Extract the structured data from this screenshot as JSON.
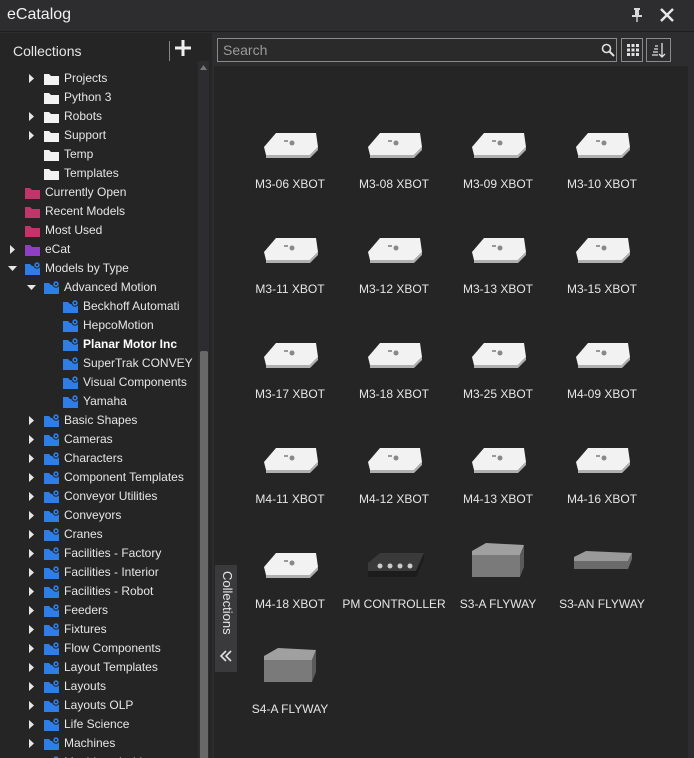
{
  "window": {
    "title": "eCatalog"
  },
  "left": {
    "header": "Collections",
    "tree": [
      {
        "label": "Projects",
        "level": 2,
        "chevron": "right",
        "icon": "folder-white"
      },
      {
        "label": "Python 3",
        "level": 2,
        "chevron": "none",
        "icon": "folder-white"
      },
      {
        "label": "Robots",
        "level": 2,
        "chevron": "right",
        "icon": "folder-white"
      },
      {
        "label": "Support",
        "level": 2,
        "chevron": "right",
        "icon": "folder-white"
      },
      {
        "label": "Temp",
        "level": 2,
        "chevron": "none",
        "icon": "folder-white"
      },
      {
        "label": "Templates",
        "level": 2,
        "chevron": "none",
        "icon": "folder-white"
      },
      {
        "label": "Currently Open",
        "level": 1,
        "chevron": "none",
        "icon": "folder-pink"
      },
      {
        "label": "Recent Models",
        "level": 1,
        "chevron": "none",
        "icon": "folder-pink"
      },
      {
        "label": "Most Used",
        "level": 1,
        "chevron": "none",
        "icon": "folder-pink"
      },
      {
        "label": "eCat",
        "level": 1,
        "chevron": "right",
        "icon": "folder-purple"
      },
      {
        "label": "Models by Type",
        "level": 1,
        "chevron": "down",
        "icon": "folder-blue-gear"
      },
      {
        "label": "Advanced Motion",
        "level": 2,
        "chevron": "down",
        "icon": "folder-blue-gear"
      },
      {
        "label": "Beckhoff Automati",
        "level": 3,
        "chevron": "none",
        "icon": "folder-blue-gear"
      },
      {
        "label": "HepcoMotion",
        "level": 3,
        "chevron": "none",
        "icon": "folder-blue-gear"
      },
      {
        "label": "Planar Motor Inc",
        "level": 3,
        "chevron": "none",
        "icon": "folder-blue-gear",
        "bold": true
      },
      {
        "label": "SuperTrak CONVEY",
        "level": 3,
        "chevron": "none",
        "icon": "folder-blue-gear"
      },
      {
        "label": "Visual Components",
        "level": 3,
        "chevron": "none",
        "icon": "folder-blue-gear"
      },
      {
        "label": "Yamaha",
        "level": 3,
        "chevron": "none",
        "icon": "folder-blue-gear"
      },
      {
        "label": "Basic Shapes",
        "level": 2,
        "chevron": "right",
        "icon": "folder-blue-gear"
      },
      {
        "label": "Cameras",
        "level": 2,
        "chevron": "right",
        "icon": "folder-blue-gear"
      },
      {
        "label": "Characters",
        "level": 2,
        "chevron": "right",
        "icon": "folder-blue-gear"
      },
      {
        "label": "Component Templates",
        "level": 2,
        "chevron": "right",
        "icon": "folder-blue-gear"
      },
      {
        "label": "Conveyor Utilities",
        "level": 2,
        "chevron": "right",
        "icon": "folder-blue-gear"
      },
      {
        "label": "Conveyors",
        "level": 2,
        "chevron": "right",
        "icon": "folder-blue-gear"
      },
      {
        "label": "Cranes",
        "level": 2,
        "chevron": "right",
        "icon": "folder-blue-gear"
      },
      {
        "label": "Facilities - Factory",
        "level": 2,
        "chevron": "right",
        "icon": "folder-blue-gear"
      },
      {
        "label": "Facilities - Interior",
        "level": 2,
        "chevron": "right",
        "icon": "folder-blue-gear"
      },
      {
        "label": "Facilities - Robot",
        "level": 2,
        "chevron": "right",
        "icon": "folder-blue-gear"
      },
      {
        "label": "Feeders",
        "level": 2,
        "chevron": "right",
        "icon": "folder-blue-gear"
      },
      {
        "label": "Fixtures",
        "level": 2,
        "chevron": "right",
        "icon": "folder-blue-gear"
      },
      {
        "label": "Flow Components",
        "level": 2,
        "chevron": "right",
        "icon": "folder-blue-gear"
      },
      {
        "label": "Layout Templates",
        "level": 2,
        "chevron": "right",
        "icon": "folder-blue-gear"
      },
      {
        "label": "Layouts",
        "level": 2,
        "chevron": "right",
        "icon": "folder-blue-gear"
      },
      {
        "label": "Layouts OLP",
        "level": 2,
        "chevron": "right",
        "icon": "folder-blue-gear"
      },
      {
        "label": "Life Science",
        "level": 2,
        "chevron": "right",
        "icon": "folder-blue-gear"
      },
      {
        "label": "Machines",
        "level": 2,
        "chevron": "right",
        "icon": "folder-blue-gear"
      },
      {
        "label": "Machines In-Line",
        "level": 2,
        "chevron": "right",
        "icon": "folder-blue-gear"
      }
    ]
  },
  "side_tab": {
    "label": "Collections"
  },
  "search": {
    "placeholder": "Search"
  },
  "items": [
    {
      "label": "M3-06 XBOT",
      "kind": "xbot"
    },
    {
      "label": "M3-08 XBOT",
      "kind": "xbot"
    },
    {
      "label": "M3-09 XBOT",
      "kind": "xbot"
    },
    {
      "label": "M3-10 XBOT",
      "kind": "xbot"
    },
    {
      "label": "M3-11 XBOT",
      "kind": "xbot"
    },
    {
      "label": "M3-12 XBOT",
      "kind": "xbot"
    },
    {
      "label": "M3-13 XBOT",
      "kind": "xbot"
    },
    {
      "label": "M3-15 XBOT",
      "kind": "xbot"
    },
    {
      "label": "M3-17 XBOT",
      "kind": "xbot"
    },
    {
      "label": "M3-18 XBOT",
      "kind": "xbot"
    },
    {
      "label": "M3-25 XBOT",
      "kind": "xbot"
    },
    {
      "label": "M4-09 XBOT",
      "kind": "xbot"
    },
    {
      "label": "M4-11 XBOT",
      "kind": "xbot"
    },
    {
      "label": "M4-12 XBOT",
      "kind": "xbot"
    },
    {
      "label": "M4-13 XBOT",
      "kind": "xbot"
    },
    {
      "label": "M4-16 XBOT",
      "kind": "xbot"
    },
    {
      "label": "M4-18 XBOT",
      "kind": "xbot"
    },
    {
      "label": "PM CONTROLLER",
      "kind": "controller"
    },
    {
      "label": "S3-A FLYWAY",
      "kind": "flyway"
    },
    {
      "label": "S3-AN FLYWAY",
      "kind": "flyway-flat"
    },
    {
      "label": "S4-A FLYWAY",
      "kind": "flyway"
    }
  ],
  "colors": {
    "folder_white": "#f2f2f2",
    "folder_pink": "#c0366b",
    "folder_purple": "#8e3fc4",
    "folder_blue": "#2f7ee8"
  }
}
